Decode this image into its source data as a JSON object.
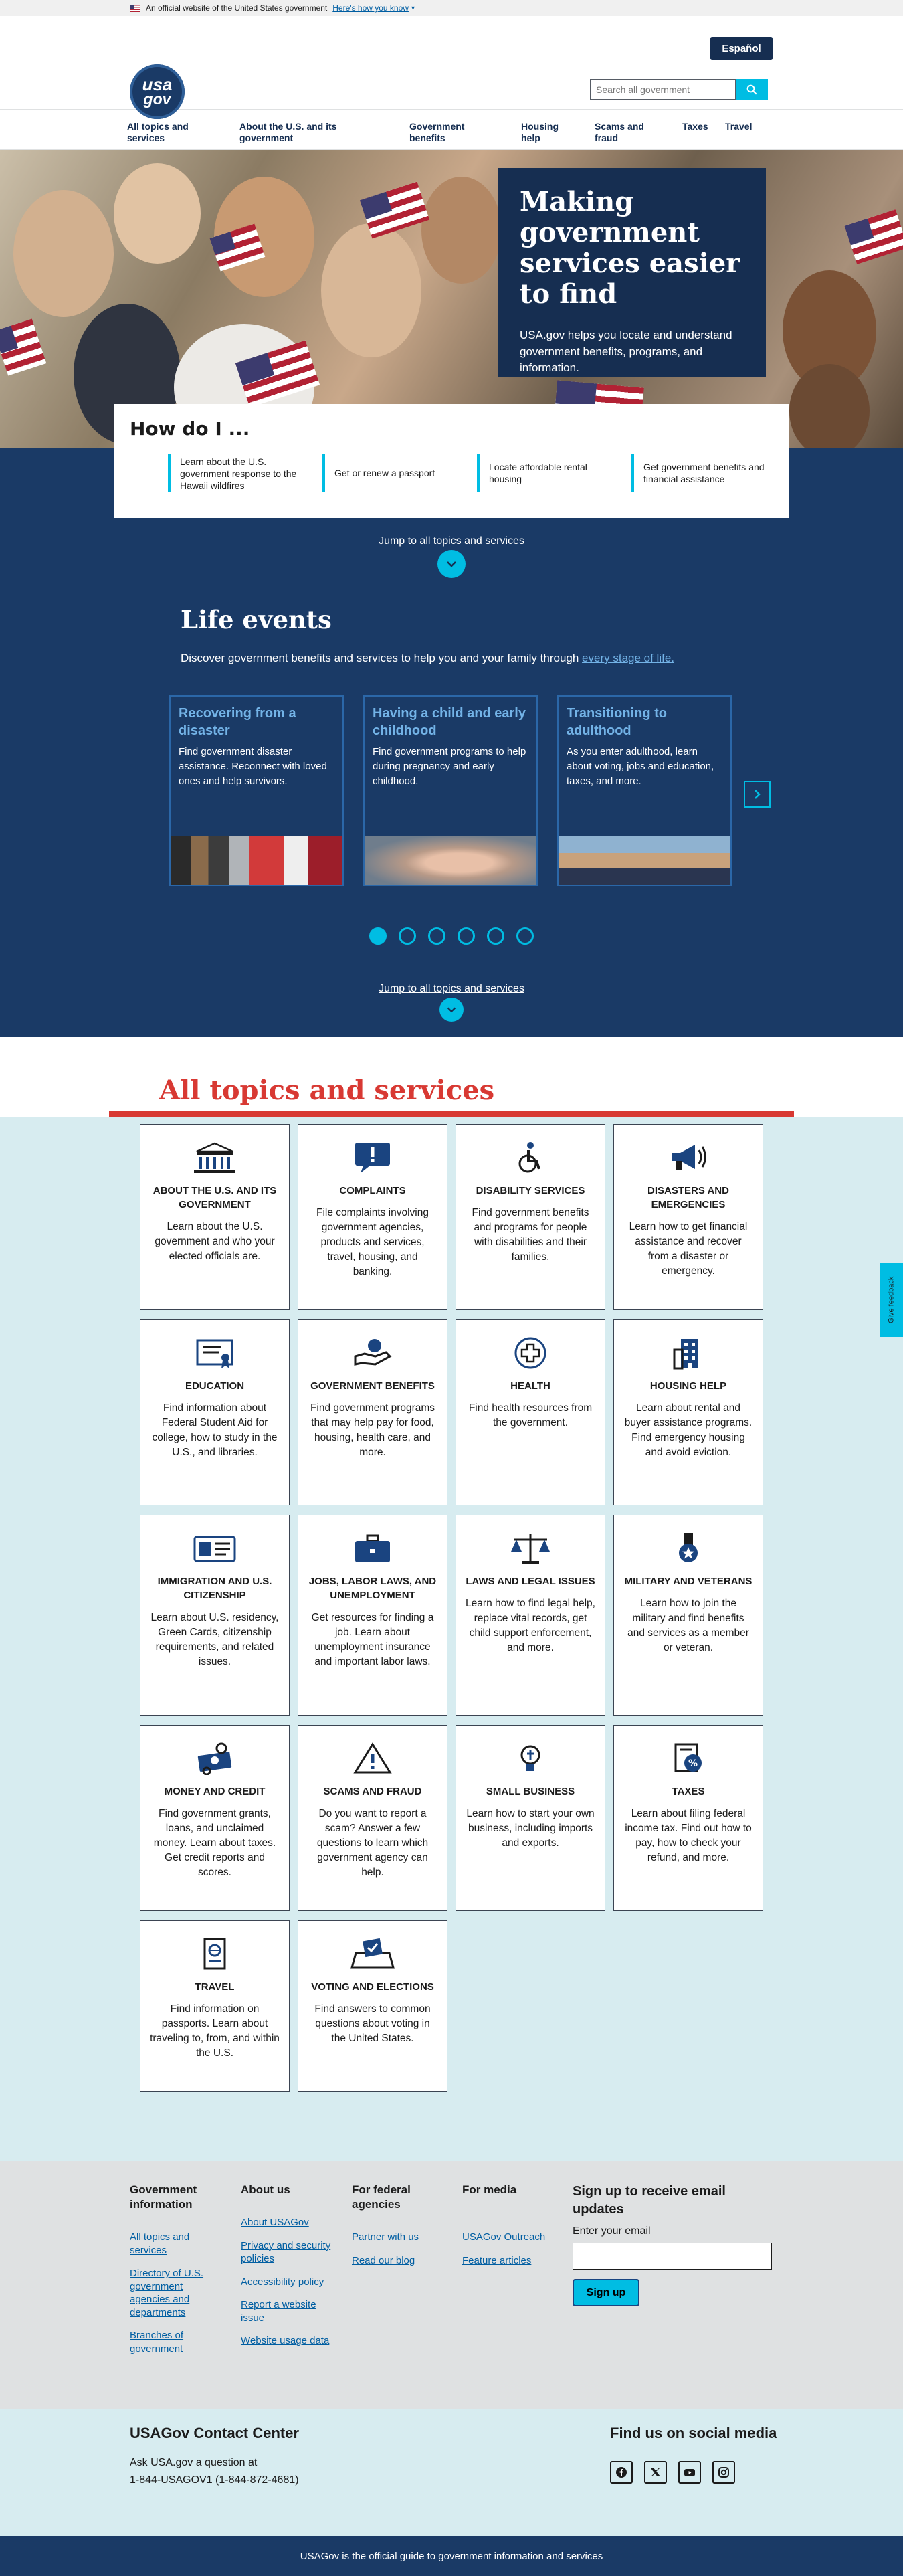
{
  "banner": {
    "text": "An official website of the United States government",
    "link": "Here's how you know"
  },
  "header": {
    "logo_line1": "usa",
    "logo_line2": "gov",
    "espanol": "Español",
    "search_placeholder": "Search all government"
  },
  "nav": [
    {
      "label": "All topics and services"
    },
    {
      "label": "About the U.S. and its government"
    },
    {
      "label": "Government benefits"
    },
    {
      "label": "Housing help"
    },
    {
      "label": "Scams and fraud"
    },
    {
      "label": "Taxes"
    },
    {
      "label": "Travel"
    }
  ],
  "hero": {
    "title": "Making government services easier to find",
    "text": "USA.gov helps you locate and understand government benefits, programs, and information."
  },
  "howdo": {
    "title": "How do I ...",
    "links": [
      "Learn about the U.S. government response to the Hawaii wildfires",
      "Get or renew a passport",
      "Locate affordable rental housing",
      "Get government benefits and financial assistance"
    ]
  },
  "jump_label": "Jump to all topics and services",
  "life": {
    "title": "Life events",
    "intro": "Discover government benefits and services to help you and your family through ",
    "intro_link": "every stage of life.",
    "cards": [
      {
        "title": "Recovering from a disaster",
        "text": "Find government disaster assistance. Reconnect with loved ones and help survivors."
      },
      {
        "title": "Having a child and early childhood",
        "text": "Find government programs to help during pregnancy and early childhood."
      },
      {
        "title": "Transitioning to adulthood",
        "text": "As you enter adulthood, learn about voting, jobs and education, taxes, and more."
      }
    ],
    "slide_count": 6,
    "active_slide": 1
  },
  "topics": {
    "title": "All topics and services",
    "tiles": [
      {
        "icon": "capitol-building-icon",
        "title": "About the U.S. and its government",
        "text": "Learn about the U.S. government and who your elected officials are."
      },
      {
        "icon": "speech-bubble-alert-icon",
        "title": "Complaints",
        "text": "File complaints involving government agencies, products and services, travel, housing, and banking."
      },
      {
        "icon": "accessibility-icon",
        "title": "Disability services",
        "text": "Find government benefits and programs for people with disabilities and their families."
      },
      {
        "icon": "megaphone-icon",
        "title": "Disasters and emergencies",
        "text": "Learn how to get financial assistance and recover from a disaster or emergency."
      },
      {
        "icon": "diploma-icon",
        "title": "Education",
        "text": "Find information about Federal Student Aid for college, how to study in the U.S., and libraries."
      },
      {
        "icon": "hand-giving-icon",
        "title": "Government benefits",
        "text": "Find government programs that may help pay for food, housing, health care, and more."
      },
      {
        "icon": "health-cross-icon",
        "title": "Health",
        "text": "Find health resources from the government."
      },
      {
        "icon": "apartment-building-icon",
        "title": "Housing help",
        "text": "Learn about rental and buyer assistance programs. Find emergency housing and avoid eviction."
      },
      {
        "icon": "id-card-icon",
        "title": "Immigration and U.S. citizenship",
        "text": "Learn about U.S. residency, Green Cards, citizenship requirements, and related issues."
      },
      {
        "icon": "briefcase-icon",
        "title": "Jobs, labor laws, and unemployment",
        "text": "Get resources for finding a job. Learn about unemployment insurance and important labor laws."
      },
      {
        "icon": "scales-icon",
        "title": "Laws and legal issues",
        "text": "Learn how to find legal help, replace vital records, get child support enforcement, and more."
      },
      {
        "icon": "medal-icon",
        "title": "Military and veterans",
        "text": "Learn how to join the military and find benefits and services as a member or veteran."
      },
      {
        "icon": "money-icon",
        "title": "Money and credit",
        "text": "Find government grants, loans, and unclaimed money. Learn about taxes. Get credit reports and scores."
      },
      {
        "icon": "warning-hook-icon",
        "title": "Scams and fraud",
        "text": "Do you want to report a scam? Answer a few questions to learn which government agency can help."
      },
      {
        "icon": "lightbulb-icon",
        "title": "Small business",
        "text": "Learn how to start your own business, including imports and exports."
      },
      {
        "icon": "tax-form-icon",
        "title": "Taxes",
        "text": "Learn about filing federal income tax. Find out how to pay, how to check your refund, and more."
      },
      {
        "icon": "passport-icon",
        "title": "Travel",
        "text": "Find information on passports. Learn about traveling to, from, and within the U.S."
      },
      {
        "icon": "ballot-box-icon",
        "title": "Voting and elections",
        "text": "Find answers to common questions about voting in the United States."
      }
    ]
  },
  "feedback_label": "Give feedback",
  "footer": {
    "columns": [
      {
        "title": "Government information",
        "links": [
          "All topics and services",
          "Directory of U.S. government agencies and departments",
          "Branches of government"
        ]
      },
      {
        "title": "About us",
        "links": [
          "About USAGov",
          "Privacy and security policies",
          "Accessibility policy",
          "Report a website issue",
          "Website usage data"
        ]
      },
      {
        "title": "For federal agencies",
        "links": [
          "Partner with us",
          "Read our blog"
        ]
      },
      {
        "title": "For media",
        "links": [
          "USAGov Outreach",
          "Feature articles"
        ]
      }
    ],
    "signup_title": "Sign up to receive email updates",
    "email_label": "Enter your email",
    "signup_button": "Sign up"
  },
  "contact": {
    "title": "USAGov Contact Center",
    "ask": "Ask USA.gov a question at",
    "phone": "1-844-USAGOV1 (1-844-872-4681)",
    "social_title": "Find us on social media",
    "socials": [
      "facebook-icon",
      "twitter-icon",
      "youtube-icon",
      "instagram-icon"
    ]
  },
  "identifier": "USAGov is the official guide to government information and services",
  "colors": {
    "navy": "#1a3a66",
    "cyan": "#00bde3",
    "red": "#d83933",
    "topics_bg": "#d7ecf0"
  }
}
